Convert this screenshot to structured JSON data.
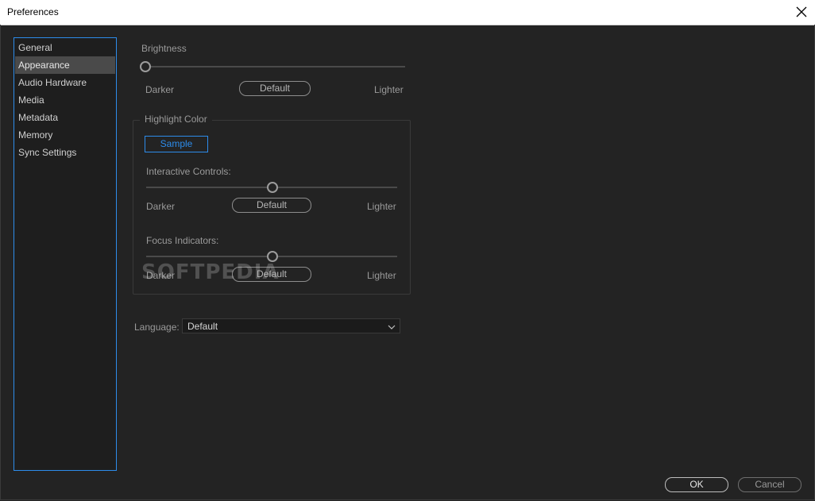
{
  "window": {
    "title": "Preferences"
  },
  "sidebar": {
    "items": [
      {
        "label": "General"
      },
      {
        "label": "Appearance"
      },
      {
        "label": "Audio Hardware"
      },
      {
        "label": "Media"
      },
      {
        "label": "Metadata"
      },
      {
        "label": "Memory"
      },
      {
        "label": "Sync Settings"
      }
    ],
    "selected": "Appearance"
  },
  "brightness": {
    "label": "Brightness",
    "left": "Darker",
    "right": "Lighter",
    "default_label": "Default",
    "value": 0.0
  },
  "highlight": {
    "legend": "Highlight Color",
    "sample_label": "Sample",
    "accent_color": "#2d8ceb",
    "interactive": {
      "label": "Interactive Controls:",
      "left": "Darker",
      "right": "Lighter",
      "default_label": "Default",
      "value": 0.5
    },
    "focus": {
      "label": "Focus Indicators:",
      "left": "Darker",
      "right": "Lighter",
      "default_label": "Default",
      "value": 0.5
    }
  },
  "language": {
    "label": "Language:",
    "value": "Default"
  },
  "watermark": "SOFTPEDIA",
  "footer": {
    "ok_label": "OK",
    "cancel_label": "Cancel"
  }
}
